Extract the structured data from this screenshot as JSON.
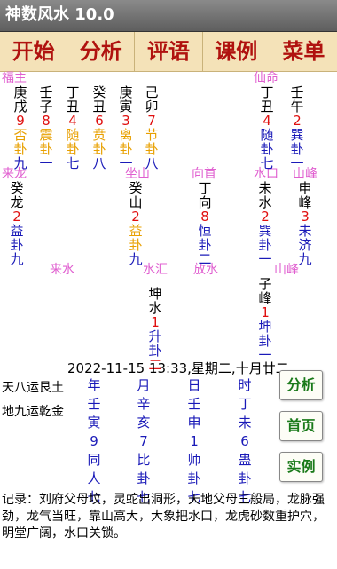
{
  "app": {
    "title": "神数风水 10.0"
  },
  "menu": [
    "开始",
    "分析",
    "评语",
    "课例",
    "菜单"
  ],
  "labels": {
    "fuzhu": "福主",
    "xianming": "仙命",
    "lailong": "来龙",
    "zuoshan": "坐山",
    "xiangshou": "向首",
    "shuikou": "水口",
    "shanfeng1": "山峰",
    "laishui": "来水",
    "shuihui": "水汇",
    "fangshui": "放水",
    "shanfeng2": "山峰"
  },
  "columns": {
    "c1": [
      "庚",
      "戌",
      "9",
      "否",
      "卦",
      "九"
    ],
    "c2": [
      "壬",
      "子",
      "8",
      "震",
      "卦",
      "一"
    ],
    "c3": [
      "丁",
      "丑",
      "4",
      "随",
      "卦",
      "七"
    ],
    "c4": [
      "癸",
      "丑",
      "6",
      "贲",
      "卦",
      "八"
    ],
    "c5": [
      "庚",
      "寅",
      "3",
      "离",
      "卦",
      "一"
    ],
    "c6": [
      "己",
      "卯",
      "7",
      "节",
      "卦",
      "八"
    ],
    "c7": [
      "丁",
      "丑",
      "4",
      "随",
      "卦",
      "七"
    ],
    "c8": [
      "壬",
      "午",
      "2",
      "巽",
      "卦",
      "一"
    ],
    "c9": [
      "癸",
      "龙",
      "2",
      "益",
      "卦",
      "九"
    ],
    "c10": [
      "癸",
      "山",
      "2",
      "益",
      "卦",
      "九"
    ],
    "c11": [
      "丁",
      "向",
      "8",
      "恒",
      "卦",
      "二"
    ],
    "c12": [
      "未",
      "水",
      "2",
      "巽",
      "卦",
      "一"
    ],
    "c13": [
      "申",
      "峰",
      "3",
      "未",
      "济",
      "九"
    ],
    "c14": [
      "坤",
      "水",
      "1",
      "升",
      "卦",
      "二"
    ],
    "c15": [
      "子",
      "峰",
      "1",
      "坤",
      "卦",
      "一"
    ]
  },
  "date": "2022-11-15 13:33,星期二,十月廿二",
  "yun": {
    "tian": "天八运艮土",
    "di": "地九运乾金"
  },
  "pillars": [
    [
      "年",
      "壬",
      "寅",
      "9",
      "同",
      "人",
      "七"
    ],
    [
      "月",
      "辛",
      "亥",
      "7",
      "比",
      "卦",
      "七"
    ],
    [
      "日",
      "壬",
      "申",
      "1",
      "师",
      "卦",
      "七"
    ],
    [
      "时",
      "丁",
      "未",
      "6",
      "蛊",
      "卦",
      "七"
    ]
  ],
  "buttons": {
    "analyze": "分析",
    "home": "首页",
    "example": "实例"
  },
  "record": "记录：刘府父母坟，灵蛇出洞形，天地父母三般局，龙脉强劲，龙气当旺，靠山高大，大象把水口，龙虎砂数重护穴，明堂广阔，水口关锁。"
}
